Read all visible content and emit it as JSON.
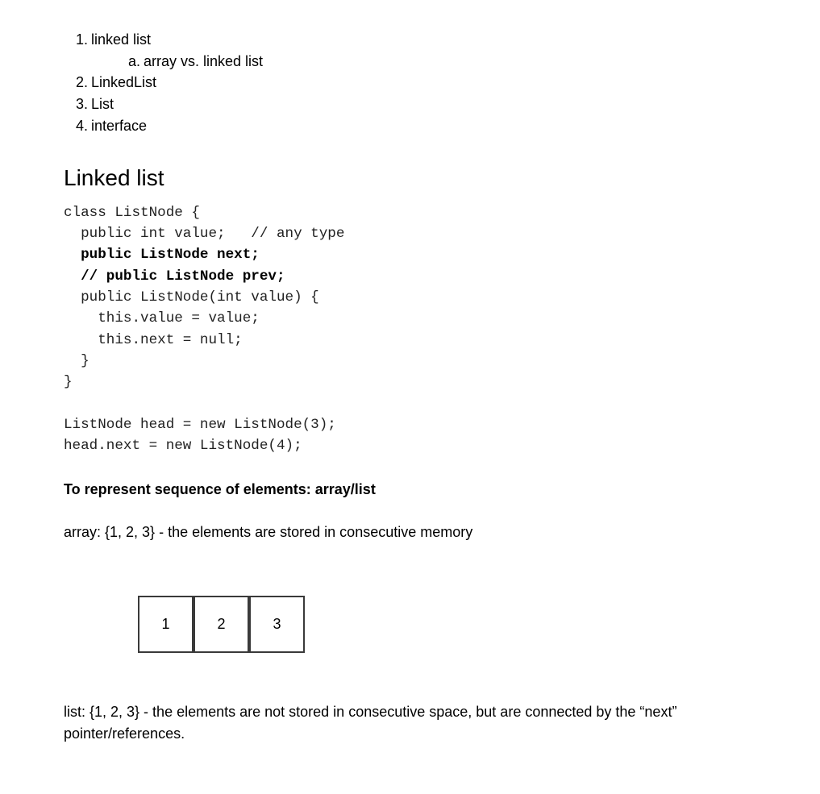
{
  "outline": [
    {
      "num": "1.",
      "text": "linked list"
    },
    {
      "num": "a.",
      "text": "array vs. linked list"
    },
    {
      "num": "2.",
      "text": "LinkedList"
    },
    {
      "num": "3.",
      "text": "List"
    },
    {
      "num": "4.",
      "text": "interface"
    }
  ],
  "section_title": "Linked list",
  "code_class": [
    "class ListNode {",
    "  public int value;   // any type",
    "  public ListNode next;",
    "  // public ListNode prev;",
    "  public ListNode(int value) {",
    "    this.value = value;",
    "    this.next = null;",
    "  }",
    "}"
  ],
  "code_usage": [
    "ListNode head = new ListNode(3);",
    "head.next = new ListNode(4);"
  ],
  "subheading": "To represent sequence of elements: array/list",
  "array_text": "array: {1, 2, 3} - the elements are stored in consecutive memory",
  "array_cells": [
    "1",
    "2",
    "3"
  ],
  "list_text": "list: {1, 2, 3} - the elements are not stored in consecutive space, but are connected by the “next” pointer/references."
}
